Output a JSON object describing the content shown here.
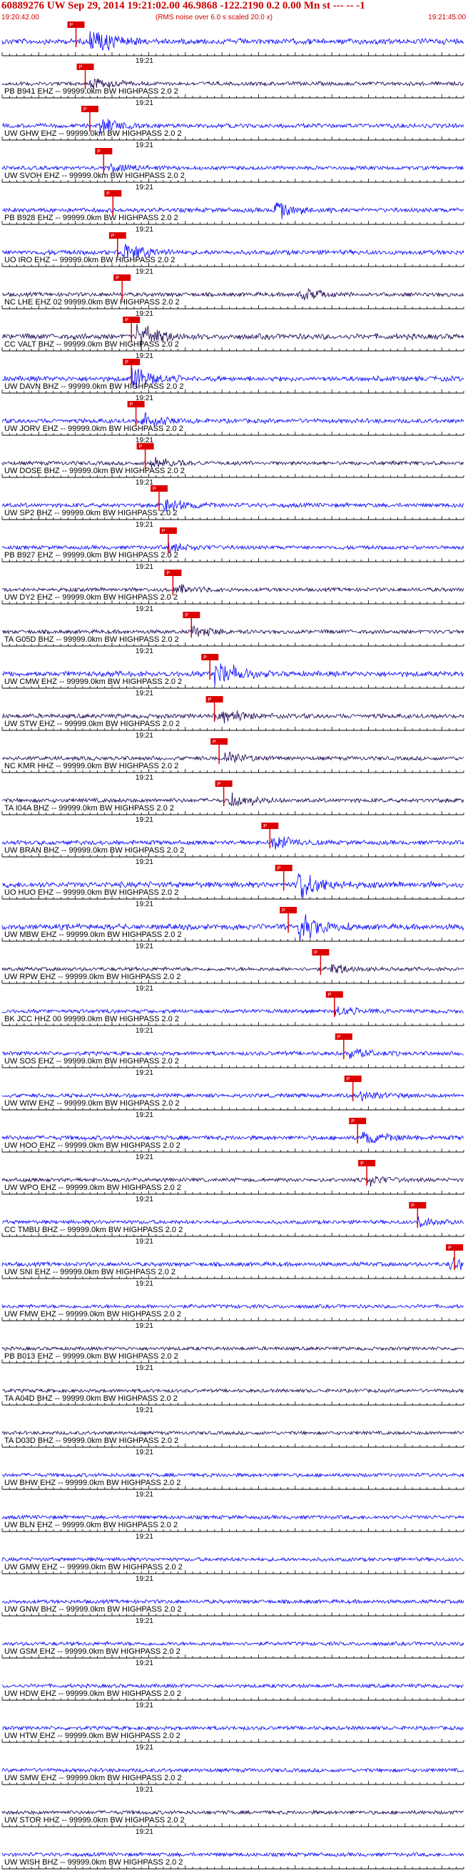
{
  "header": {
    "title": "60889276 UW Sep 29, 2014 19:21:02.00   46.9868 -122.2190  0.2 0.00 Mn st --- -- -1",
    "start_time": "19:20:42.00",
    "rms_note": "(RMS noise over 6.0 s scaled 20.0 x)",
    "end_time": "19:21:45.00"
  },
  "colors": {
    "trace_a": "#0000ff",
    "trace_b": "#1a0050",
    "pick": "#dd0000",
    "axis": "#000000"
  },
  "chart_data": {
    "type": "seismogram",
    "x_range": [
      "19:20:42.00",
      "19:21:45.00"
    ],
    "time_tick_label": "19:21",
    "channels": [
      {
        "label": "",
        "color": "blue",
        "pick": 0.16,
        "pick_label": "P",
        "amp": 0.9,
        "burst": 0.2
      },
      {
        "label": "PB B941 EHZ -- 99999.0km BW  HIGHPASS  2.0  2",
        "color": "dark",
        "pick": 0.18,
        "pick_label": "P",
        "amp": 0.35,
        "burst": 0.2
      },
      {
        "label": "UW GHW EHZ -- 99999.0km BW  HIGHPASS  2.0  2",
        "color": "blue",
        "pick": 0.19,
        "pick_label": "P",
        "amp": 0.45,
        "burst": 0.22
      },
      {
        "label": "UW SVOH EHZ -- 99999.0km BW  HIGHPASS  2.0  2",
        "color": "blue",
        "pick": 0.22,
        "pick_label": "P",
        "amp": 0.3,
        "burst": 0.24
      },
      {
        "label": "PB B928 EHZ -- 99999.0km BW  HIGHPASS  2.0  2",
        "color": "blue",
        "pick": 0.24,
        "pick_label": "P",
        "amp": 0.5,
        "burst": 0.6
      },
      {
        "label": "UO IRO EHZ -- 99999.0km BW  HIGHPASS  2.0  2",
        "color": "blue",
        "pick": 0.25,
        "pick_label": "P",
        "amp": 0.6,
        "burst": 0.27
      },
      {
        "label": "NC LHE EHZ 02 99999.0km BW  HIGHPASS  2.0  2",
        "color": "dark",
        "pick": 0.26,
        "pick_label": "P",
        "amp": 0.4,
        "burst": 0.65
      },
      {
        "label": "CC VALT BHZ -- 99999.0km BW  HIGHPASS  2.0  2",
        "color": "dark",
        "pick": 0.28,
        "pick_label": "P",
        "amp": 0.9,
        "burst": 0.3
      },
      {
        "label": "UW DAVN BHZ -- 99999.0km BW  HIGHPASS  2.0  2",
        "color": "blue",
        "pick": 0.28,
        "pick_label": "P",
        "amp": 0.7,
        "burst": 0.29
      },
      {
        "label": "UW JORV EHZ -- 99999.0km BW  HIGHPASS  2.0  2",
        "color": "blue",
        "pick": 0.29,
        "pick_label": "P",
        "amp": 0.5,
        "burst": 0.31
      },
      {
        "label": "UW DOSE BHZ -- 99999.0km BW  HIGHPASS  2.0  2",
        "color": "dark",
        "pick": 0.31,
        "pick_label": "P",
        "amp": 0.35,
        "burst": 0.33
      },
      {
        "label": "UW SP2 BHZ -- 99999.0km BW  HIGHPASS  2.0  2",
        "color": "blue",
        "pick": 0.34,
        "pick_label": "P",
        "amp": 0.45,
        "burst": 0.36
      },
      {
        "label": "PB B927 EHZ -- 99999.0km BW  HIGHPASS  2.0  2",
        "color": "blue",
        "pick": 0.36,
        "pick_label": "P",
        "amp": 0.3,
        "burst": 0.37
      },
      {
        "label": "UW DY2 EHZ -- 99999.0km BW  HIGHPASS  2.0  2",
        "color": "dark",
        "pick": 0.37,
        "pick_label": "P",
        "amp": 0.3,
        "burst": 0.38
      },
      {
        "label": "TA G05D BHZ -- 99999.0km BW  HIGHPASS  2.0  2",
        "color": "dark",
        "pick": 0.41,
        "pick_label": "P",
        "amp": 0.35,
        "burst": 0.42
      },
      {
        "label": "UW CMW EHZ -- 99999.0km BW  HIGHPASS  2.0  2",
        "color": "blue",
        "pick": 0.45,
        "pick_label": "P",
        "amp": 0.8,
        "burst": 0.47
      },
      {
        "label": "UW STW EHZ -- 99999.0km BW  HIGHPASS  2.0  2",
        "color": "dark",
        "pick": 0.46,
        "pick_label": "P",
        "amp": 0.55,
        "burst": 0.47
      },
      {
        "label": "NC KMR HHZ -- 99999.0km BW  HIGHPASS  2.0  2",
        "color": "dark",
        "pick": 0.47,
        "pick_label": "P",
        "amp": 0.35,
        "burst": 0.49
      },
      {
        "label": "TA I04A BHZ -- 99999.0km BW  HIGHPASS  2.0  2",
        "color": "dark",
        "pick": 0.48,
        "pick_label": "P",
        "amp": 0.45,
        "burst": 0.5
      },
      {
        "label": "UW BRAN BHZ -- 99999.0km BW  HIGHPASS  2.0  2",
        "color": "blue",
        "pick": 0.58,
        "pick_label": "P",
        "amp": 0.5,
        "burst": 0.59
      },
      {
        "label": "UO HUO EHZ -- 99999.0km BW  HIGHPASS  2.0  2",
        "color": "blue",
        "pick": 0.61,
        "pick_label": "P",
        "amp": 0.95,
        "burst": 0.65
      },
      {
        "label": "UW MBW EHZ -- 99999.0km BW  HIGHPASS  2.0  2",
        "color": "blue",
        "pick": 0.62,
        "pick_label": "P",
        "amp": 0.9,
        "burst": 0.65
      },
      {
        "label": "UW RPW EHZ -- 99999.0km BW  HIGHPASS  2.0  2",
        "color": "dark",
        "pick": 0.69,
        "pick_label": "P",
        "amp": 0.3,
        "burst": 0.72
      },
      {
        "label": "BK JCC HHZ 00 99999.0km BW  HIGHPASS  2.0  2",
        "color": "blue",
        "pick": 0.72,
        "pick_label": "P",
        "amp": 0.3,
        "burst": 0.73
      },
      {
        "label": "UW SOS EHZ -- 99999.0km BW  HIGHPASS  2.0  2",
        "color": "blue",
        "pick": 0.74,
        "pick_label": "P",
        "amp": 0.35,
        "burst": 0.76
      },
      {
        "label": "UW WIW EHZ -- 99999.0km BW  HIGHPASS  2.0  2",
        "color": "blue",
        "pick": 0.76,
        "pick_label": "P",
        "amp": 0.35,
        "burst": 0.78
      },
      {
        "label": "UW HOO EHZ -- 99999.0km BW  HIGHPASS  2.0  2",
        "color": "blue",
        "pick": 0.77,
        "pick_label": "P",
        "amp": 0.5,
        "burst": 0.79
      },
      {
        "label": "UW WPO EHZ -- 99999.0km BW  HIGHPASS  2.0  2",
        "color": "dark",
        "pick": 0.79,
        "pick_label": "P",
        "amp": 0.3,
        "burst": 0.8
      },
      {
        "label": "CC TMBU BHZ -- 99999.0km BW  HIGHPASS  2.0  2",
        "color": "blue",
        "pick": 0.9,
        "pick_label": "P",
        "amp": 0.3,
        "burst": 0.91
      },
      {
        "label": "UW SNI EHZ -- 99999.0km BW  HIGHPASS  2.0  2",
        "color": "blue",
        "pick": 0.98,
        "pick_label": "P",
        "amp": 0.45,
        "burst": 0.98
      },
      {
        "label": "UW FMW EHZ -- 99999.0km BW  HIGHPASS  2.0  2",
        "color": "blue",
        "pick": null,
        "pick_label": "",
        "amp": 0.3,
        "burst": null
      },
      {
        "label": "PB B013 EHZ -- 99999.0km BW  HIGHPASS  2.0  2",
        "color": "dark",
        "pick": null,
        "pick_label": "",
        "amp": 0.2,
        "burst": null
      },
      {
        "label": "TA A04D BHZ -- 99999.0km BW  HIGHPASS  2.0  2",
        "color": "dark",
        "pick": null,
        "pick_label": "",
        "amp": 0.2,
        "burst": null
      },
      {
        "label": "TA D03D BHZ -- 99999.0km BW  HIGHPASS  2.0  2",
        "color": "dark",
        "pick": null,
        "pick_label": "",
        "amp": 0.2,
        "burst": null
      },
      {
        "label": "UW BHW EHZ -- 99999.0km BW  HIGHPASS  2.0  2",
        "color": "blue",
        "pick": null,
        "pick_label": "",
        "amp": 0.3,
        "burst": null
      },
      {
        "label": "UW BLN EHZ -- 99999.0km BW  HIGHPASS  2.0  2",
        "color": "blue",
        "pick": null,
        "pick_label": "",
        "amp": 0.3,
        "burst": null
      },
      {
        "label": "UW GMW EHZ -- 99999.0km BW  HIGHPASS  2.0  2",
        "color": "blue",
        "pick": null,
        "pick_label": "",
        "amp": 0.3,
        "burst": null
      },
      {
        "label": "UW GNW BHZ -- 99999.0km BW  HIGHPASS  2.0  2",
        "color": "blue",
        "pick": null,
        "pick_label": "",
        "amp": 0.3,
        "burst": null
      },
      {
        "label": "UW GSM EHZ -- 99999.0km BW  HIGHPASS  2.0  2",
        "color": "blue",
        "pick": null,
        "pick_label": "",
        "amp": 0.3,
        "burst": null
      },
      {
        "label": "UW HDW EHZ -- 99999.0km BW  HIGHPASS  2.0  2",
        "color": "blue",
        "pick": null,
        "pick_label": "",
        "amp": 0.3,
        "burst": null
      },
      {
        "label": "UW HTW EHZ -- 99999.0km BW  HIGHPASS  2.0  2",
        "color": "blue",
        "pick": null,
        "pick_label": "",
        "amp": 0.3,
        "burst": null
      },
      {
        "label": "UW SMW EHZ -- 99999.0km BW  HIGHPASS  2.0  2",
        "color": "blue",
        "pick": null,
        "pick_label": "",
        "amp": 0.3,
        "burst": null
      },
      {
        "label": "UW STOR HHZ -- 99999.0km BW  HIGHPASS  2.0  2",
        "color": "dark",
        "pick": null,
        "pick_label": "",
        "amp": 0.3,
        "burst": null
      },
      {
        "label": "UW WISH BHZ -- 99999.0km BW  HIGHPASS  2.0  2",
        "color": "blue",
        "pick": null,
        "pick_label": "",
        "amp": 0.3,
        "burst": null
      }
    ]
  }
}
